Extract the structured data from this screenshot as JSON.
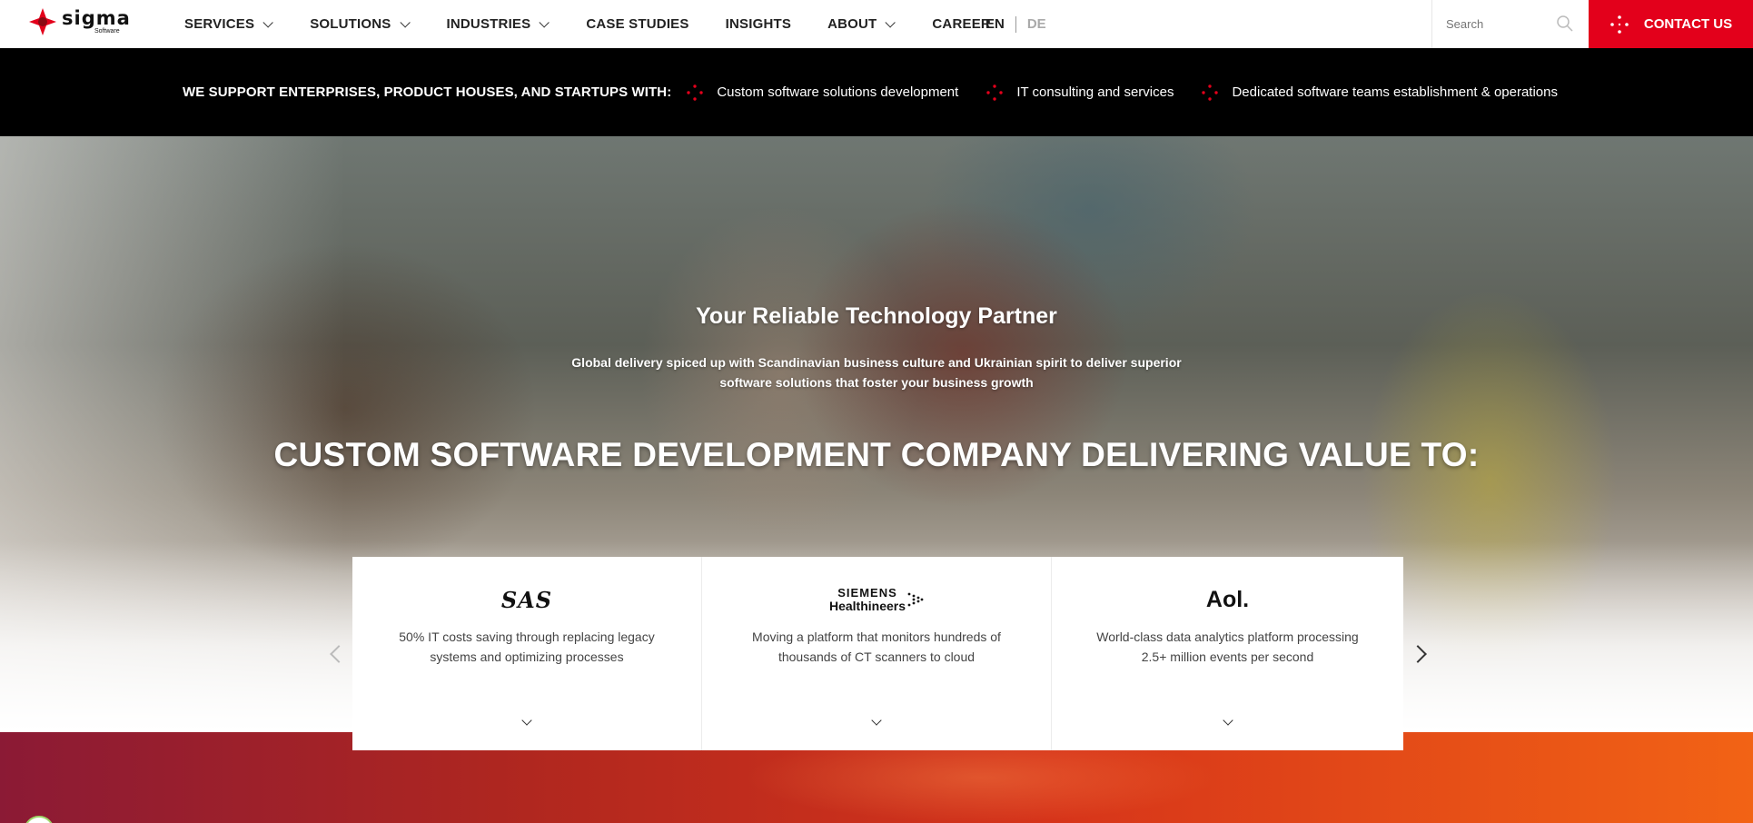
{
  "header": {
    "logo": {
      "word": "sigma",
      "sub": "Software"
    },
    "nav": [
      {
        "label": "SERVICES",
        "dropdown": true
      },
      {
        "label": "SOLUTIONS",
        "dropdown": true
      },
      {
        "label": "INDUSTRIES",
        "dropdown": true
      },
      {
        "label": "CASE STUDIES",
        "dropdown": false
      },
      {
        "label": "INSIGHTS",
        "dropdown": false
      },
      {
        "label": "ABOUT",
        "dropdown": true
      },
      {
        "label": "CAREER",
        "dropdown": false
      }
    ],
    "languages": {
      "active": "EN",
      "inactive": "DE"
    },
    "search": {
      "placeholder": "Search"
    },
    "contact_label": "CONTACT US",
    "brand_color": "#e3001b"
  },
  "support_bar": {
    "heading": "WE SUPPORT ENTERPRISES, PRODUCT HOUSES, AND STARTUPS WITH:",
    "items": [
      "Custom software solutions development",
      "IT consulting and services",
      "Dedicated software teams establishment & operations"
    ]
  },
  "hero": {
    "title": "Your Reliable Technology Partner",
    "subtitle": "Global delivery spiced up with Scandinavian business culture and Ukrainian spirit to deliver superior software solutions that foster your business growth",
    "headline": "CUSTOM SOFTWARE DEVELOPMENT COMPANY DELIVERING VALUE TO:"
  },
  "cases": [
    {
      "logo": "SAS",
      "text": "50% IT costs saving through replacing legacy systems and optimizing processes"
    },
    {
      "logo_top": "SIEMENS",
      "logo_bottom": "Healthineers",
      "text": "Moving a platform that monitors hundreds of thousands of CT scanners to cloud"
    },
    {
      "logo": "Aol.",
      "text": "World-class data analytics platform processing 2.5+ million events per second"
    }
  ],
  "icons": {
    "brand": "sigma-logo-icon",
    "search": "search-icon",
    "contact": "dots-icon",
    "bullet": "red-dots-icon",
    "prev": "chevron-left-icon",
    "next": "chevron-right-icon",
    "expand": "chevron-down-icon"
  }
}
